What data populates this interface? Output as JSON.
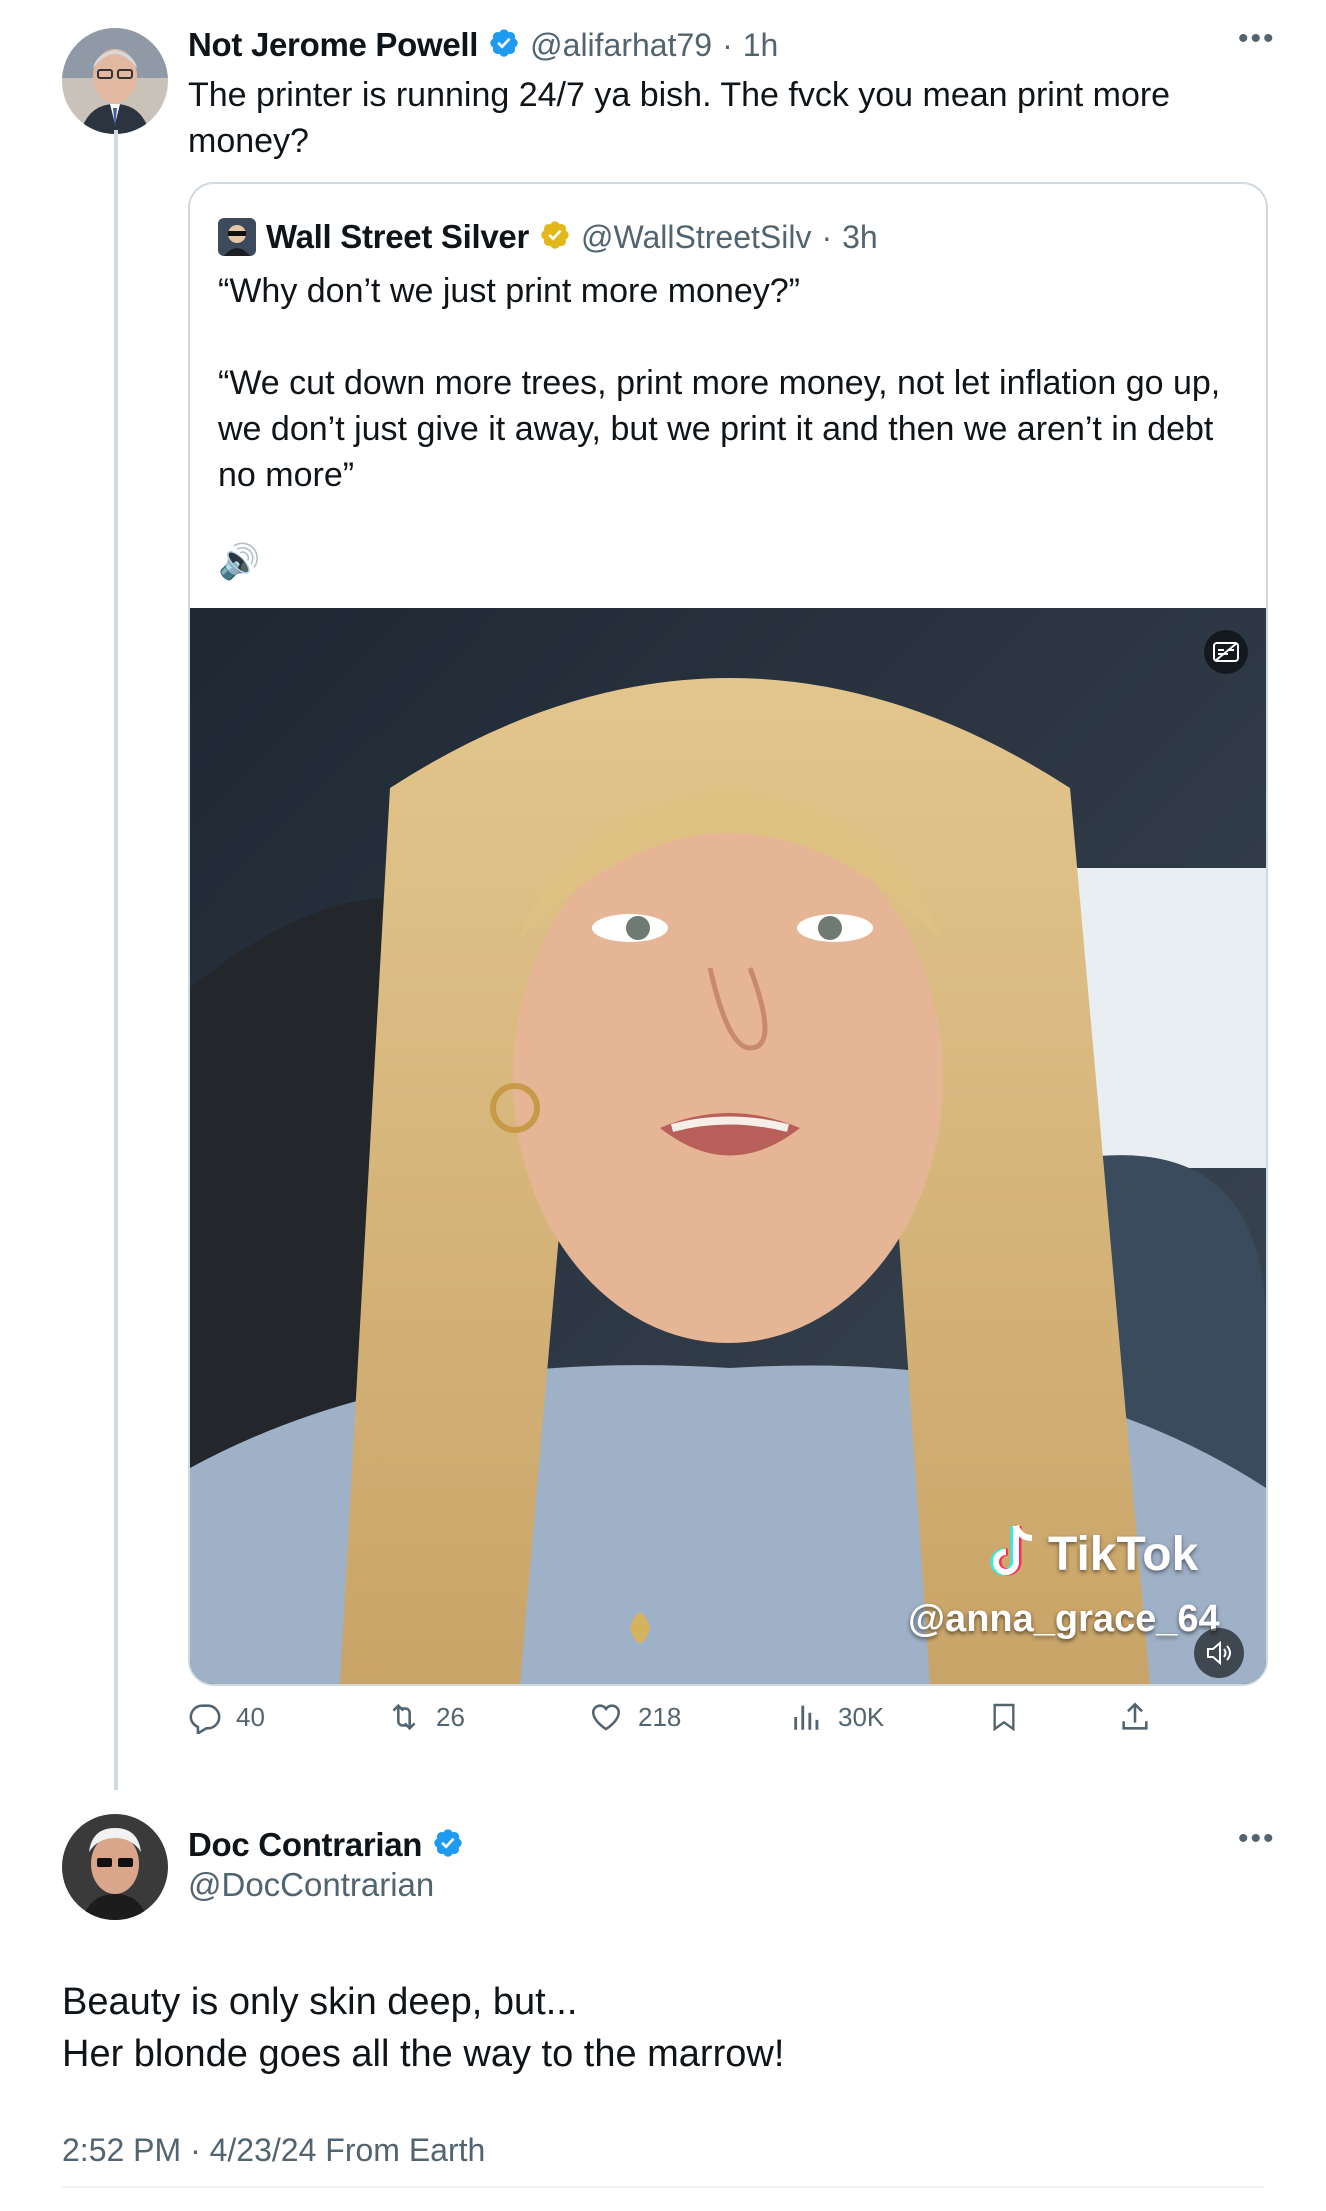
{
  "tweet": {
    "author_name": "Not Jerome Powell",
    "handle": "@alifarhat79",
    "separator": "·",
    "time": "1h",
    "text": "The printer is running 24/7 ya bish. The fvck you mean print more money?"
  },
  "quoted": {
    "author_name": "Wall Street Silver",
    "handle": "@WallStreetSilv",
    "separator": "·",
    "time": "3h",
    "text": "“Why don’t we just print more money?”\n\n“We cut down more trees, print more money, not let inflation go up, we don’t just give it away, but we print it and then we aren’t in debt no more”",
    "emoji": "🔊",
    "video": {
      "watermark_brand": "TikTok",
      "watermark_handle": "@anna_grace_64"
    }
  },
  "actions": {
    "replies": "40",
    "reposts": "26",
    "likes": "218",
    "views": "30K"
  },
  "reply": {
    "author_name": "Doc Contrarian",
    "handle": "@DocContrarian",
    "text_line1": "Beauty is only skin deep, but...",
    "text_line2": "Her blonde goes all the way to the marrow!",
    "timestamp": "2:52 PM · 4/23/24 From Earth"
  },
  "icons": {
    "verified_blue": "verified-badge-icon",
    "verified_gold": "verified-gold-badge-icon",
    "more": "more-icon",
    "reply": "reply-icon",
    "repost": "repost-icon",
    "like": "heart-icon",
    "views": "views-icon",
    "bookmark": "bookmark-icon",
    "share": "share-icon",
    "mute": "mute-icon",
    "captions": "captions-icon"
  },
  "colors": {
    "verified_blue": "#1d9bf0",
    "verified_gold": "#e2b719",
    "muted_text": "#536471",
    "border": "#cfd9de"
  }
}
